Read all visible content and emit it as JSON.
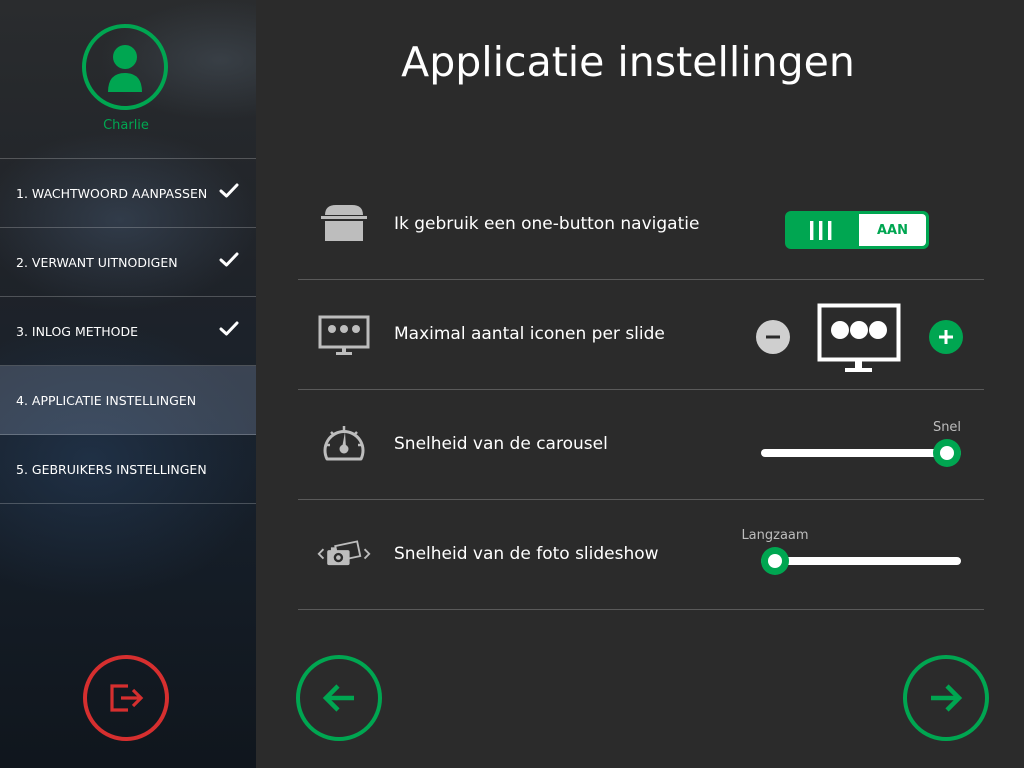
{
  "user": {
    "name": "Charlie"
  },
  "sidebar": {
    "items": [
      {
        "label": "1. WACHTWOORD AANPASSEN",
        "completed": true,
        "active": false
      },
      {
        "label": "2. VERWANT UITNODIGEN",
        "completed": true,
        "active": false
      },
      {
        "label": "3. INLOG METHODE",
        "completed": true,
        "active": false
      },
      {
        "label": "4. APPLICATIE INSTELLINGEN",
        "completed": false,
        "active": true
      },
      {
        "label": "5. GEBRUIKERS INSTELLINGEN",
        "completed": false,
        "active": false
      }
    ]
  },
  "main": {
    "title": "Applicatie instellingen",
    "settings": {
      "one_button": {
        "label": "Ik gebruik een one-button navigatie",
        "toggle_state": "AAN",
        "icon": "button-icon"
      },
      "icons_per_slide": {
        "label": "Maximal aantal iconen per slide",
        "icon": "monitor-dots-icon",
        "preview_icon": "monitor-three-dots-icon",
        "value": 3
      },
      "carousel_speed": {
        "label": "Snelheid van de carousel",
        "icon": "speedometer-icon",
        "caption": "Snel",
        "value_fraction": 0.93
      },
      "slideshow_speed": {
        "label": "Snelheid van de foto slideshow",
        "icon": "photo-slideshow-icon",
        "caption": "Langzaam",
        "value_fraction": 0.07
      }
    }
  },
  "colors": {
    "accent": "#00a651",
    "danger": "#d62f2f",
    "background": "#2b2b2b",
    "divider": "#5a5a5a"
  }
}
